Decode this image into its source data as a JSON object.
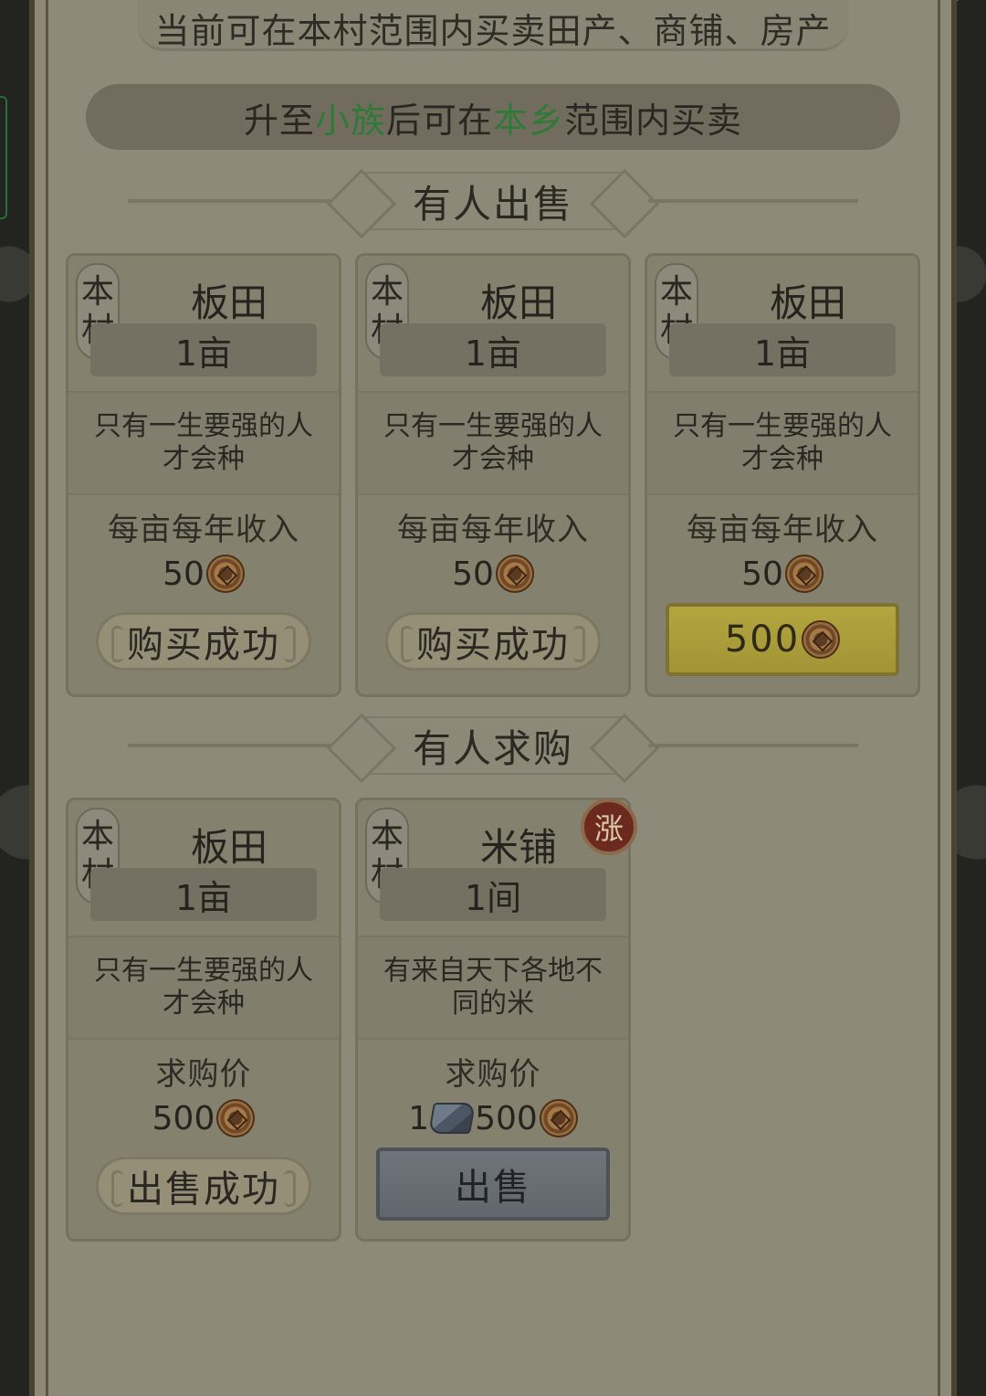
{
  "notice": {
    "text": "当前可在本村范围内买卖田产、商铺、房产"
  },
  "upgrade": {
    "prefix": "升至",
    "rank": "小族",
    "middle": "后可在",
    "area": "本乡",
    "suffix": "范围内买卖"
  },
  "sections": {
    "selling": "有人出售",
    "buying": "有人求购"
  },
  "selling": [
    {
      "loc1": "本",
      "loc2": "村",
      "name": "板田",
      "qty": "1亩",
      "desc": "只有一生要强的人才会种",
      "price_label": "每亩每年收入",
      "price": "50",
      "button": "购买成功",
      "state": "done"
    },
    {
      "loc1": "本",
      "loc2": "村",
      "name": "板田",
      "qty": "1亩",
      "desc": "只有一生要强的人才会种",
      "price_label": "每亩每年收入",
      "price": "50",
      "button": "购买成功",
      "state": "done"
    },
    {
      "loc1": "本",
      "loc2": "村",
      "name": "板田",
      "qty": "1亩",
      "desc": "只有一生要强的人才会种",
      "price_label": "每亩每年收入",
      "price": "50",
      "button": "500",
      "state": "buy"
    }
  ],
  "buying": [
    {
      "loc1": "本",
      "loc2": "村",
      "name": "板田",
      "qty": "1亩",
      "desc": "只有一生要强的人才会种",
      "price_label": "求购价",
      "price": "500",
      "button": "出售成功",
      "state": "done"
    },
    {
      "loc1": "本",
      "loc2": "村",
      "name": "米铺",
      "qty": "1间",
      "desc": "有来自天下各地不同的米",
      "price_label": "求购价",
      "price_silver": "1",
      "price": "500",
      "button": "出售",
      "state": "sell",
      "badge": "涨"
    }
  ],
  "icons": {
    "coin": "copper-coin-icon",
    "silver": "silver-ingot-icon"
  },
  "colors": {
    "highlight_text": "#2f7a36",
    "buy_button": "#b3a53f",
    "sell_button": "#6f747a",
    "rise_badge": "#6c2a1f"
  }
}
